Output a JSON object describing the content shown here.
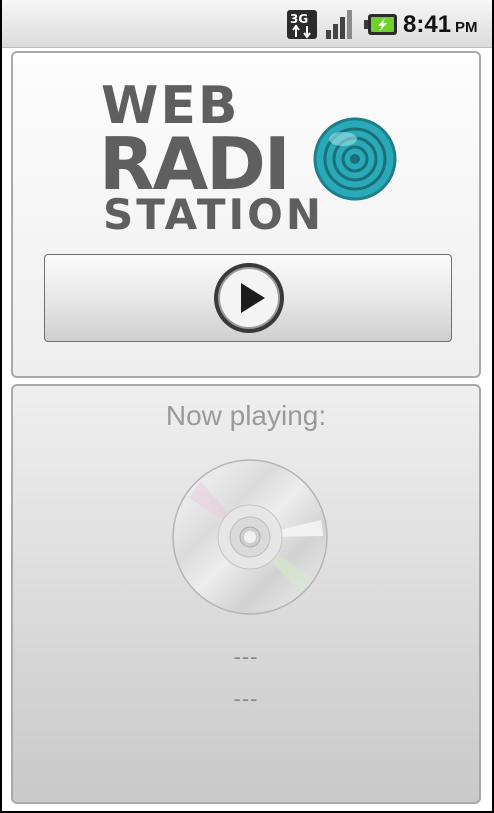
{
  "status_bar": {
    "network_label": "3G",
    "network_icon": "network-3g-icon",
    "signal_icon": "signal-bars-icon",
    "battery_icon": "battery-charging-icon",
    "time": "8:41",
    "ampm": "PM"
  },
  "logo": {
    "line1": "WEB",
    "line2": "RADI",
    "line3": "STATION",
    "accent_color": "#2aa9b8"
  },
  "player": {
    "play_icon": "play-icon"
  },
  "now_playing": {
    "label": "Now playing:",
    "disc_icon": "cd-disc-icon",
    "artist": "---",
    "title": "---"
  },
  "colors": {
    "text_gray": "#9a9a9a",
    "logo_gray": "#5f5f5f",
    "teal": "#2aa9b8"
  }
}
